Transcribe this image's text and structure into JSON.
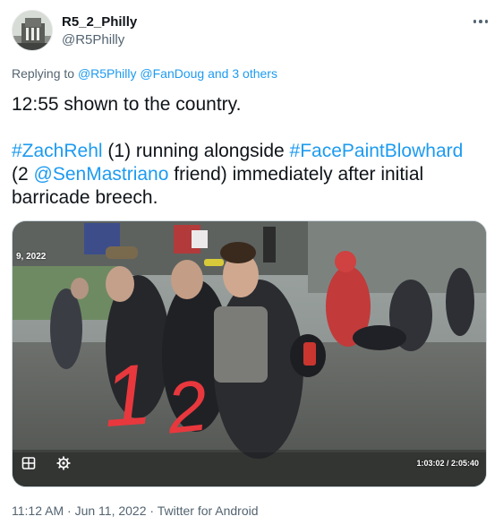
{
  "tweet": {
    "display_name": "R5_2_Philly",
    "handle": "@R5Philly",
    "more_icon": "more-horizontal-icon",
    "reply": {
      "prefix": "Replying to ",
      "mention_1": "@R5Philly",
      "mention_2": "@FanDoug",
      "others": "and 3 others"
    },
    "text": {
      "line1": "12:55 shown to the country.",
      "hashtag_1": "#ZachRehl",
      "part_1": " (1) running alongside ",
      "hashtag_2": "#FacePaintBlowhard",
      "part_2": "(2 ",
      "mention": "@SenMastriano",
      "part_3": " friend) immediately after initial barricade breech."
    },
    "media": {
      "overlay_date": "9, 2022",
      "timecode": "1:03:02 / 2:05:40",
      "annotation": "1 2",
      "annotation_color": "#e8383d",
      "icons": [
        "grid-icon",
        "settings-gear-icon"
      ]
    },
    "meta": {
      "time": "11:12 AM",
      "separator": " · ",
      "date": "Jun 11, 2022",
      "source": "Twitter for Android"
    }
  },
  "colors": {
    "link": "#1d9bf0",
    "text": "#0f1419",
    "secondary": "#536471"
  }
}
